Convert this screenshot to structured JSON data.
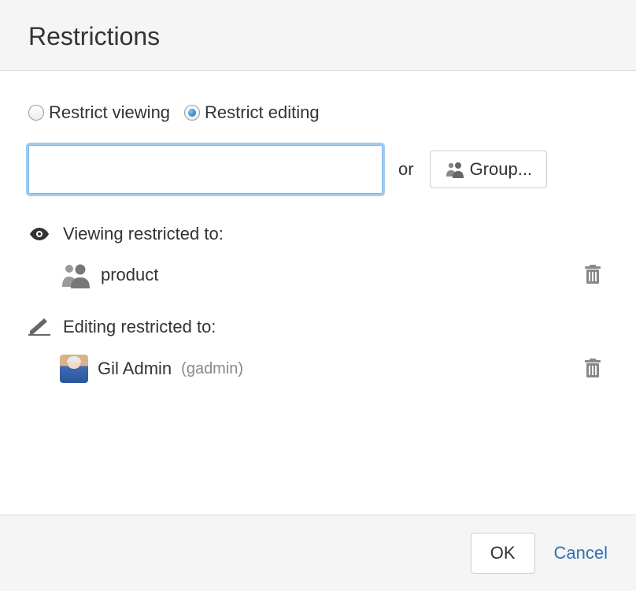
{
  "header": {
    "title": "Restrictions"
  },
  "radios": {
    "viewing": "Restrict viewing",
    "editing": "Restrict editing"
  },
  "inputRow": {
    "or": "or",
    "groupButton": "Group..."
  },
  "sections": {
    "viewing": {
      "label": "Viewing restricted to:",
      "entries": [
        {
          "name": "product",
          "type": "group"
        }
      ]
    },
    "editing": {
      "label": "Editing restricted to:",
      "entries": [
        {
          "name": "Gil Admin",
          "username": "(gadmin)",
          "type": "user"
        }
      ]
    }
  },
  "footer": {
    "ok": "OK",
    "cancel": "Cancel"
  }
}
